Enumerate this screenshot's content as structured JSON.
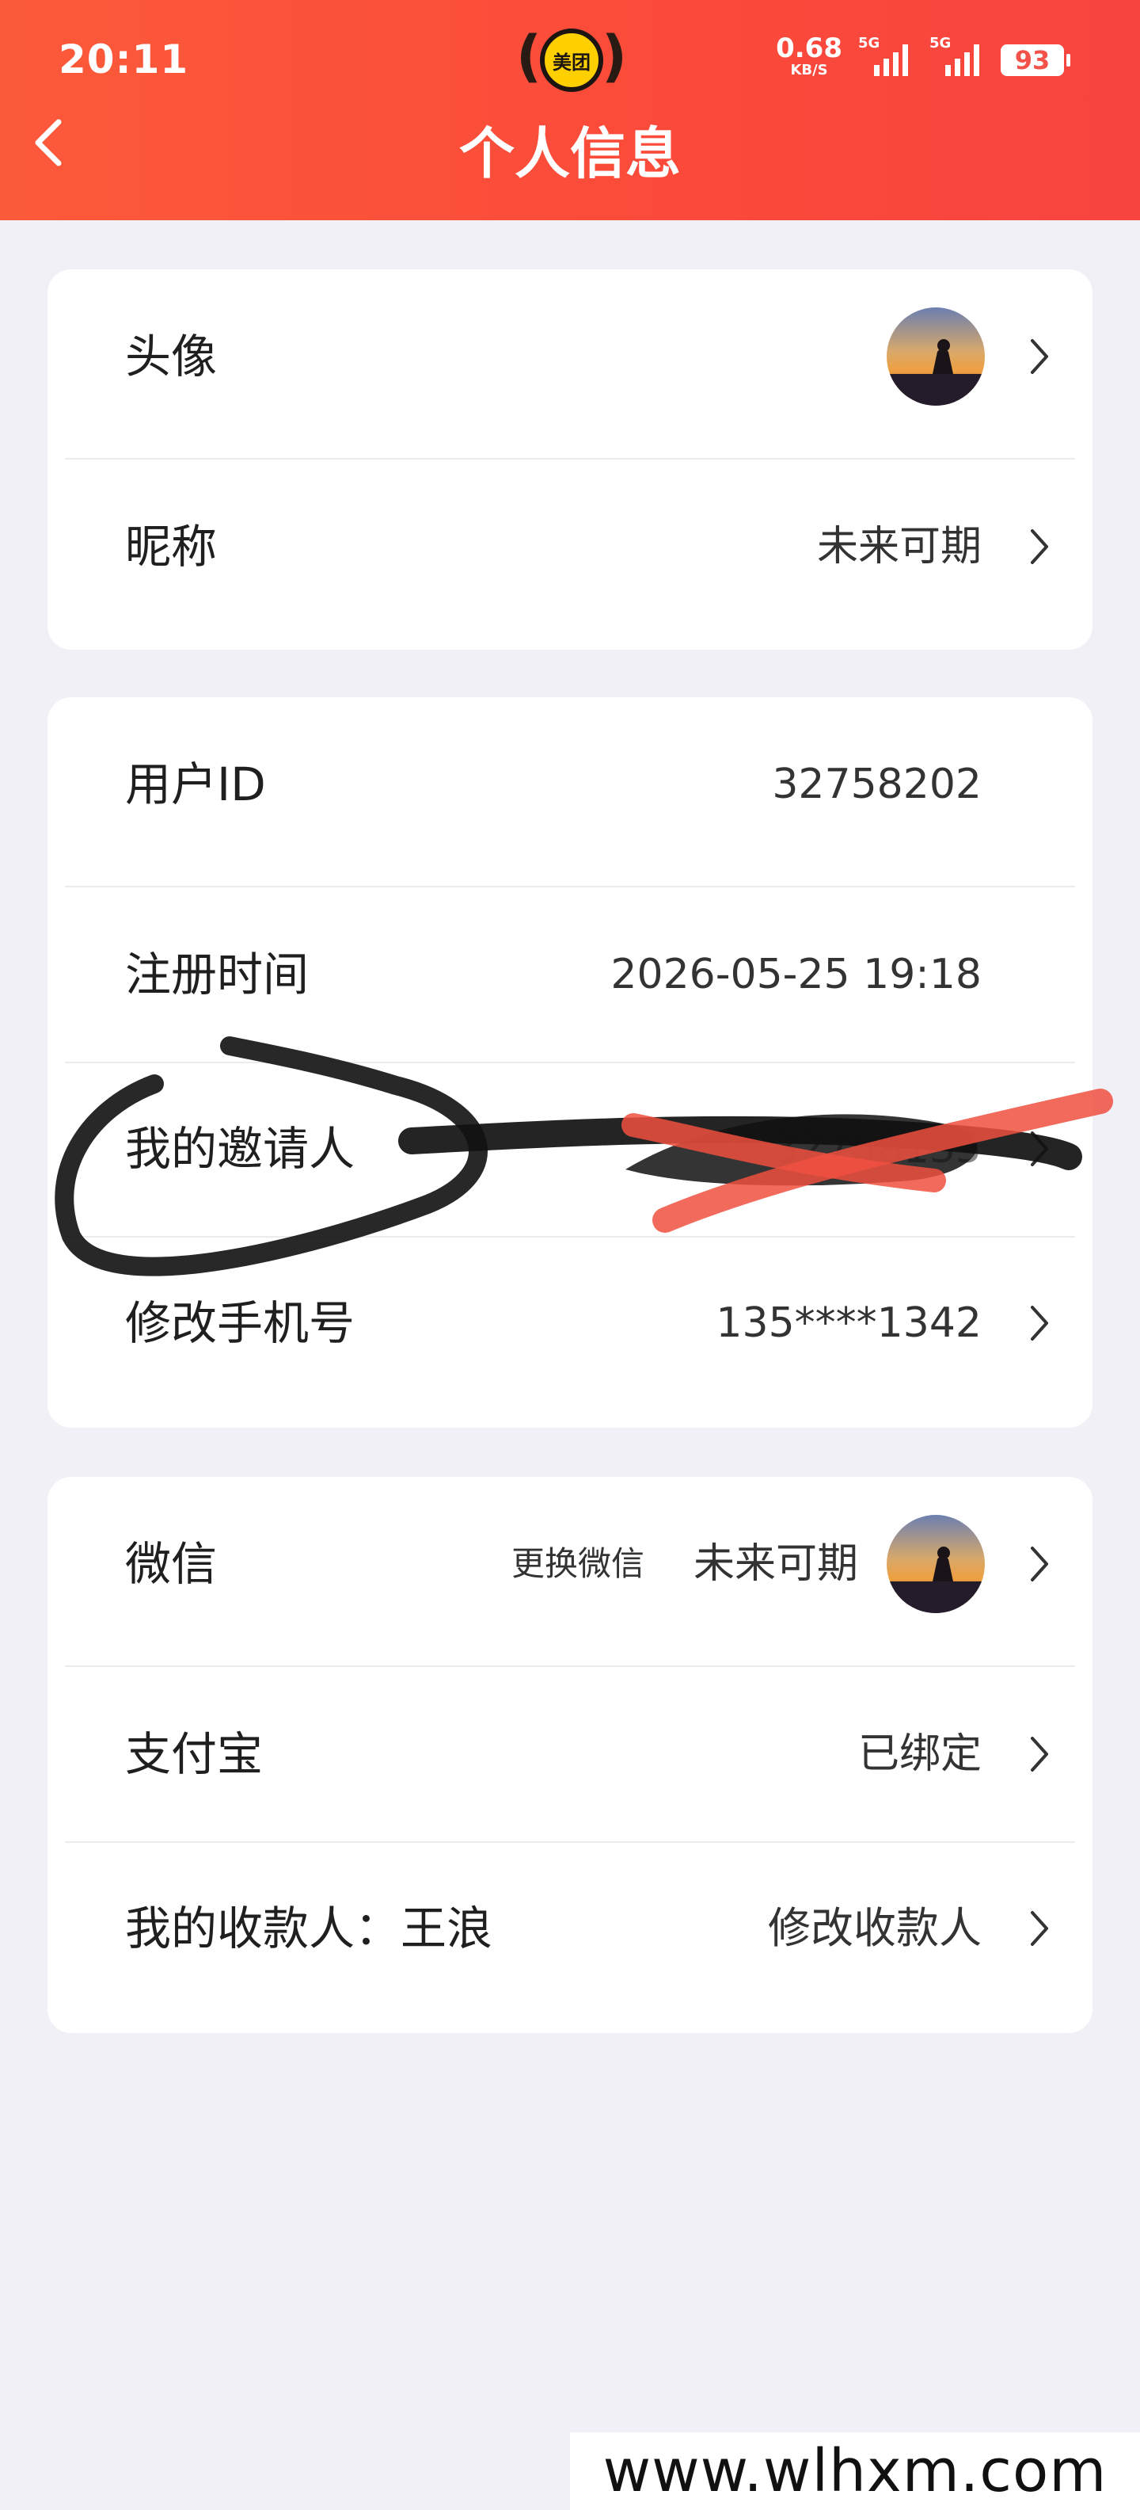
{
  "status_bar": {
    "time": "20:11",
    "app_badge": "美团",
    "net_speed_value": "0.68",
    "net_speed_unit": "KB/S",
    "sim1_label": "5G",
    "sim2_label": "5G",
    "battery": "93"
  },
  "header": {
    "title": "个人信息",
    "back_icon": "chevron-left-icon",
    "background_color": "#fb4d3b"
  },
  "profile_card": {
    "avatar_label": "头像",
    "nickname_label": "昵称",
    "nickname_value": "未来可期"
  },
  "account_card": {
    "user_id_label": "用户ID",
    "user_id_value": "32758202",
    "register_label": "注册时间",
    "register_value": "2026-05-25 19:18",
    "inviter_label": "我的邀请人",
    "inviter_value": "32758135",
    "phone_label": "修改手机号",
    "phone_value": "135****1342"
  },
  "binding_card": {
    "wechat_label": "微信",
    "wechat_change_link": "更换微信",
    "wechat_name": "未来可期",
    "alipay_label": "支付宝",
    "alipay_value": "已绑定",
    "payee_label": "我的收款人：王浪",
    "payee_action": "修改收款人"
  },
  "watermark": "www.wlhxm.com",
  "colors": {
    "link": "#4a8fd6",
    "page_background": "#f1f0f7"
  }
}
